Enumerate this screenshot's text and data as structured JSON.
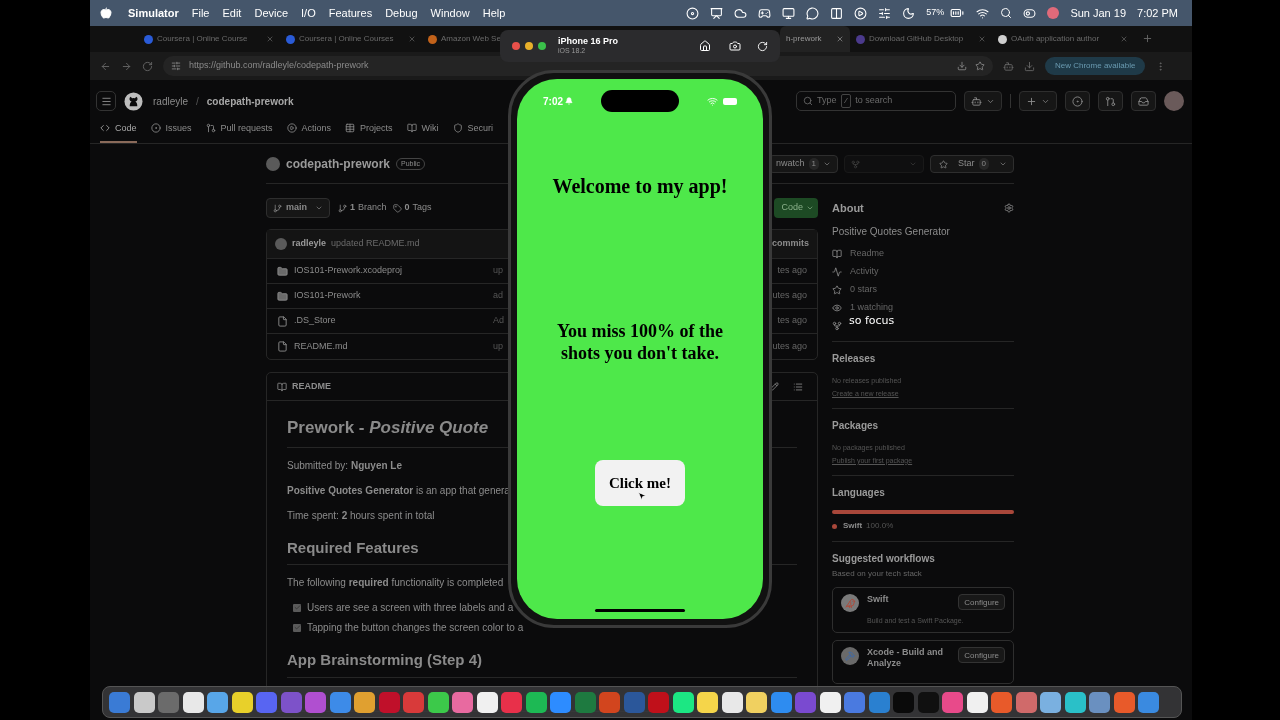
{
  "menu_bar": {
    "app": "Simulator",
    "menus": [
      "File",
      "Edit",
      "Device",
      "I/O",
      "Features",
      "Debug",
      "Window",
      "Help"
    ],
    "battery": "57%",
    "date": "Sun Jan 19",
    "time": "7:02 PM"
  },
  "browser": {
    "tabs": [
      {
        "title": "Coursera | Online Course",
        "selected": false
      },
      {
        "title": "Coursera | Online Courses",
        "selected": false
      },
      {
        "title": "Amazon Web Se",
        "selected": false
      },
      {
        "title": "h-prework",
        "selected": true
      },
      {
        "title": "Download GitHub Desktop",
        "selected": false
      },
      {
        "title": "OAuth application author",
        "selected": false
      }
    ],
    "url": "https://github.com/radleyle/codepath-prework",
    "update": "New Chrome available"
  },
  "github": {
    "owner": "radleyle",
    "separator": "/",
    "repo": "codepath-prework",
    "search": {
      "before": "Type",
      "key": "/",
      "after": "to search"
    },
    "nav": [
      {
        "label": "Code",
        "selected": true
      },
      {
        "label": "Issues",
        "selected": false
      },
      {
        "label": "Pull requests",
        "selected": false
      },
      {
        "label": "Actions",
        "selected": false
      },
      {
        "label": "Projects",
        "selected": false
      },
      {
        "label": "Wiki",
        "selected": false
      },
      {
        "label": "Securi",
        "selected": false
      }
    ],
    "repo_title": "codepath-prework",
    "visibility": "Public",
    "watch": {
      "label": "nwatch",
      "count": "1"
    },
    "star": {
      "label": "Star",
      "count": "0"
    },
    "branch": "main",
    "branches": {
      "count": "1",
      "label": "Branch"
    },
    "tags": {
      "count": "0",
      "label": "Tags"
    },
    "code_button": "Code",
    "last_commit": {
      "author": "radleyle",
      "message": "updated README.md",
      "right": "commits"
    },
    "files": [
      {
        "kind": "folder",
        "name": "IOS101-Prework.xcodeproj",
        "message": "up",
        "time": "tes ago"
      },
      {
        "kind": "folder",
        "name": "IOS101-Prework",
        "message": "ad",
        "time": "utes ago"
      },
      {
        "kind": "file",
        "name": ".DS_Store",
        "message": "Ad",
        "time": "tes ago"
      },
      {
        "kind": "file",
        "name": "README.md",
        "message": "up",
        "time": "utes ago"
      }
    ],
    "readme": {
      "tab": "README",
      "title": "Prework - *Positive Quote*",
      "blocks": [
        {
          "kind": "p",
          "text": "Submitted by: **Nguyen Le**"
        },
        {
          "kind": "p",
          "text": "**Positive Quotes Generator** is an app that genera"
        },
        {
          "kind": "p",
          "text": "Time spent: **2** hours spent in total"
        },
        {
          "kind": "h2",
          "text": "Required Features"
        },
        {
          "kind": "p",
          "text": "The following **required** functionality is completed"
        },
        {
          "kind": "task",
          "text": "Users are see a screen with three labels and a",
          "checked": true
        },
        {
          "kind": "task",
          "text": "Tapping the button changes the screen color to a",
          "checked": true
        },
        {
          "kind": "h2",
          "text": "App Brainstorming (Step 4)"
        }
      ]
    },
    "about": {
      "title": "About",
      "description": "Positive Quotes Generator",
      "links": [
        "Readme",
        "Activity",
        "0 stars",
        "1 watching"
      ]
    },
    "releases": {
      "title": "Releases",
      "note": "No releases published",
      "link": "Create a new release"
    },
    "packages": {
      "title": "Packages",
      "note": "No packages published",
      "link": "Publish your first package"
    },
    "languages": {
      "title": "Languages",
      "items": [
        {
          "name": "Swift",
          "share": "100.0%",
          "color": "#a8473a",
          "level": 1
        }
      ]
    },
    "workflows": {
      "title": "Suggested workflows",
      "subtitle": "Based on your tech stack",
      "items": [
        {
          "name": "Swift",
          "description": "Build and test a Swift Package.",
          "action": "Configure"
        },
        {
          "name": "Xcode - Build and Analyze",
          "action": "Configure"
        }
      ]
    }
  },
  "simulator": {
    "device": "iPhone 16 Pro",
    "os": "iOS 18.2",
    "clock": "7:02",
    "title": "Welcome to my app!",
    "quote": "You miss 100% of the shots you don't take.",
    "button": "Click me!"
  },
  "caption": "so focus"
}
